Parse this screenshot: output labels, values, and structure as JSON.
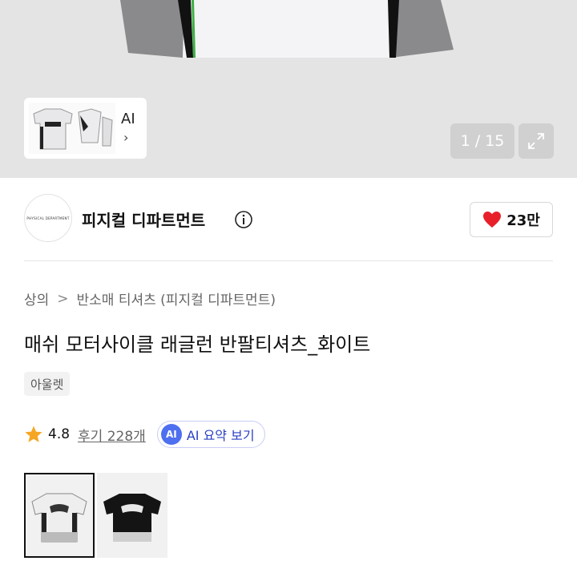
{
  "gallery": {
    "ai_chip_label": "AI",
    "ai_chip_arrow": "›",
    "counter": "1 / 15",
    "expand_icon": "expand-icon"
  },
  "brand": {
    "name": "피지컬 디파트먼트",
    "logo_text": "PHYSICAL DEPARTMENT",
    "info_icon": "info-icon",
    "like_icon": "heart-icon",
    "like_color": "#e8202a",
    "like_count": "23만"
  },
  "breadcrumb": {
    "items": [
      "상의",
      "반소매 티셔츠 (피지컬 디파트먼트)"
    ],
    "separator": ">"
  },
  "product": {
    "title": "매쉬 모터사이클 래글런 반팔티셔츠_화이트",
    "badge": "아울렛"
  },
  "rating": {
    "star_icon": "star-icon",
    "star_color": "#f5a623",
    "value": "4.8",
    "reviews": "후기 228개",
    "ai_badge": "AI",
    "ai_summary": "AI 요약 보기"
  },
  "variants": [
    {
      "name": "white",
      "selected": true
    },
    {
      "name": "black",
      "selected": false
    }
  ]
}
